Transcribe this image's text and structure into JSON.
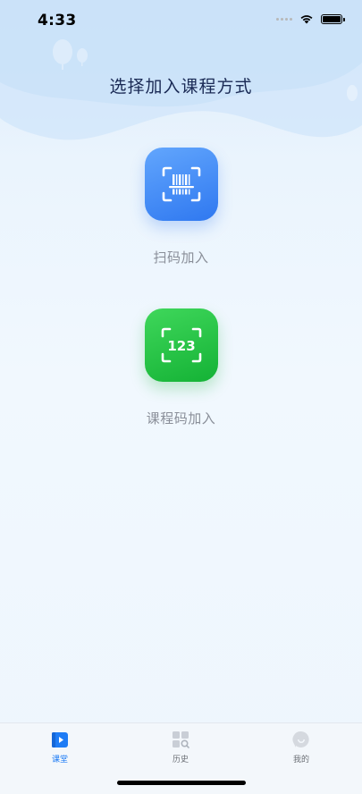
{
  "status_bar": {
    "time": "4:33"
  },
  "page": {
    "title": "选择加入课程方式"
  },
  "options": [
    {
      "label": "扫码加入",
      "icon": "barcode-scan-icon",
      "color": "#3b86f8"
    },
    {
      "label": "课程码加入",
      "icon": "course-code-icon",
      "icon_text": "123",
      "color": "#22c23f"
    }
  ],
  "tab_bar": {
    "items": [
      {
        "label": "课堂",
        "icon": "classroom-icon",
        "active": true
      },
      {
        "label": "历史",
        "icon": "history-icon",
        "active": false
      },
      {
        "label": "我的",
        "icon": "profile-icon",
        "active": false
      }
    ],
    "active_color": "#1e7cf5"
  }
}
